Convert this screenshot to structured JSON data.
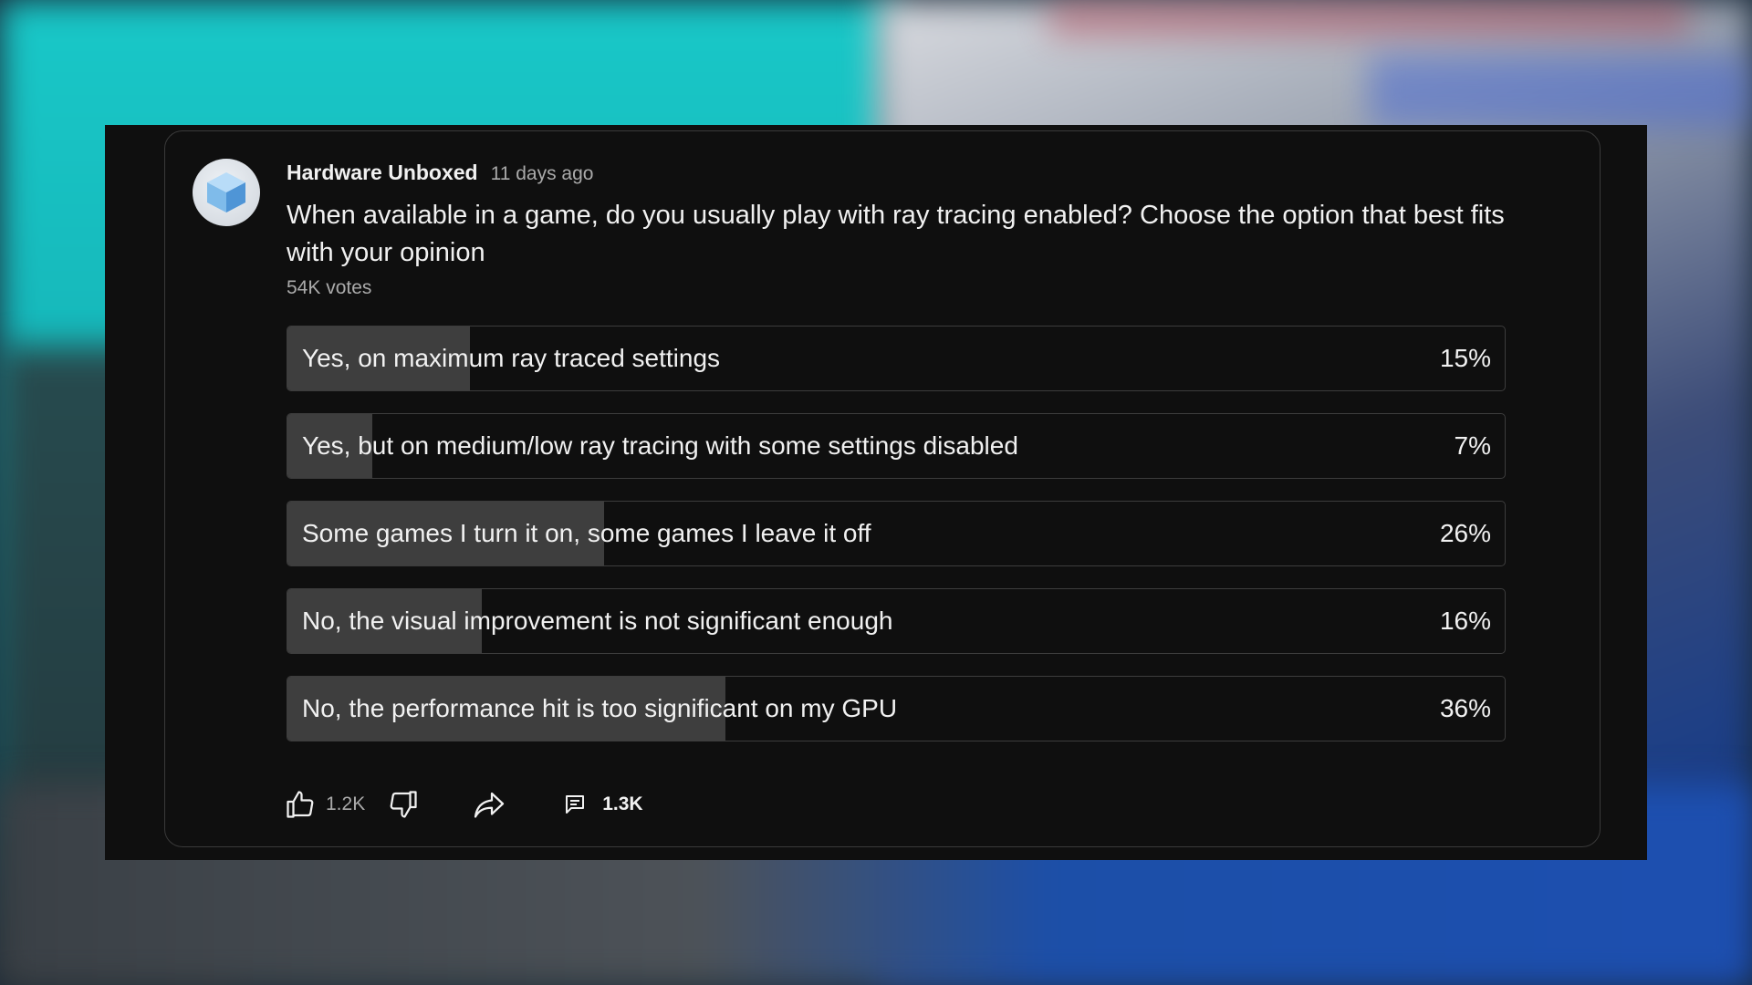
{
  "post": {
    "channel": "Hardware Unboxed",
    "time": "11 days ago",
    "question": "When available in a game, do you usually play with ray tracing enabled? Choose the option that best fits with your opinion",
    "votes": "54K votes"
  },
  "poll": {
    "options": [
      {
        "label": "Yes, on maximum ray traced settings",
        "percent_text": "15%",
        "percent": 15
      },
      {
        "label": "Yes, but on medium/low ray tracing with some settings disabled",
        "percent_text": "7%",
        "percent": 7
      },
      {
        "label": "Some games I turn it on, some games I leave it off",
        "percent_text": "26%",
        "percent": 26
      },
      {
        "label": "No, the visual improvement is not significant enough",
        "percent_text": "16%",
        "percent": 16
      },
      {
        "label": "No, the performance hit is too significant on my GPU",
        "percent_text": "36%",
        "percent": 36
      }
    ]
  },
  "actions": {
    "likes": "1.2K",
    "comments": "1.3K",
    "icons": [
      "thumbs-up-icon",
      "thumbs-down-icon",
      "share-icon",
      "comment-icon"
    ]
  },
  "colors": {
    "card_bg": "#0f0f0f",
    "bar_fill": "#3e3e3e",
    "text_primary": "#f1f1f1",
    "text_secondary": "#aaaaaa",
    "border": "#3d3d3d",
    "avatar_cube": "#6fb0e8"
  }
}
